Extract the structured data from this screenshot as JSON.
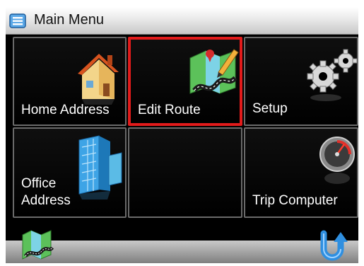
{
  "window": {
    "title": "Main Menu",
    "title_icon": "menu-list-icon"
  },
  "tiles": [
    {
      "label": "Home Address",
      "icon": "house-icon",
      "selected": false
    },
    {
      "label": "Edit Route",
      "icon": "map-pen-icon",
      "selected": true
    },
    {
      "label": "Setup",
      "icon": "gears-icon",
      "selected": false
    },
    {
      "label": "Office Address",
      "label_lines": [
        "Office",
        "Address"
      ],
      "icon": "office-building-icon",
      "selected": false
    },
    {
      "label": "",
      "icon": "",
      "selected": false
    },
    {
      "label": "Trip Computer",
      "icon": "speedometer-icon",
      "selected": false
    }
  ],
  "bottom_bar": {
    "left_button_icon": "map-icon",
    "right_button_icon": "back-arrow-icon"
  },
  "colors": {
    "selection_border": "#e21b1b",
    "tile_border": "#6a6a6a",
    "background": "#000000"
  }
}
